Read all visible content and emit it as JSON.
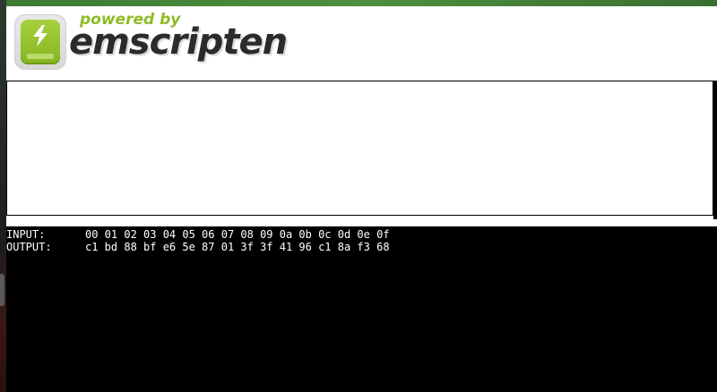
{
  "header": {
    "powered_by": "powered by",
    "brand": "emscripten",
    "logo_icon": "lightning-bolt-icon",
    "brand_color": "#8dbb25"
  },
  "canvas": {
    "background": "#ffffff",
    "border": "#000000"
  },
  "console": {
    "background": "#000000",
    "text_color": "#ffffff",
    "lines": [
      {
        "label": "INPUT:",
        "value": "00 01 02 03 04 05 06 07 08 09 0a 0b 0c 0d 0e 0f"
      },
      {
        "label": "OUTPUT:",
        "value": "c1 bd 88 bf e6 5e 87 01 3f 3f 41 96 c1 8a f3 68"
      }
    ]
  }
}
